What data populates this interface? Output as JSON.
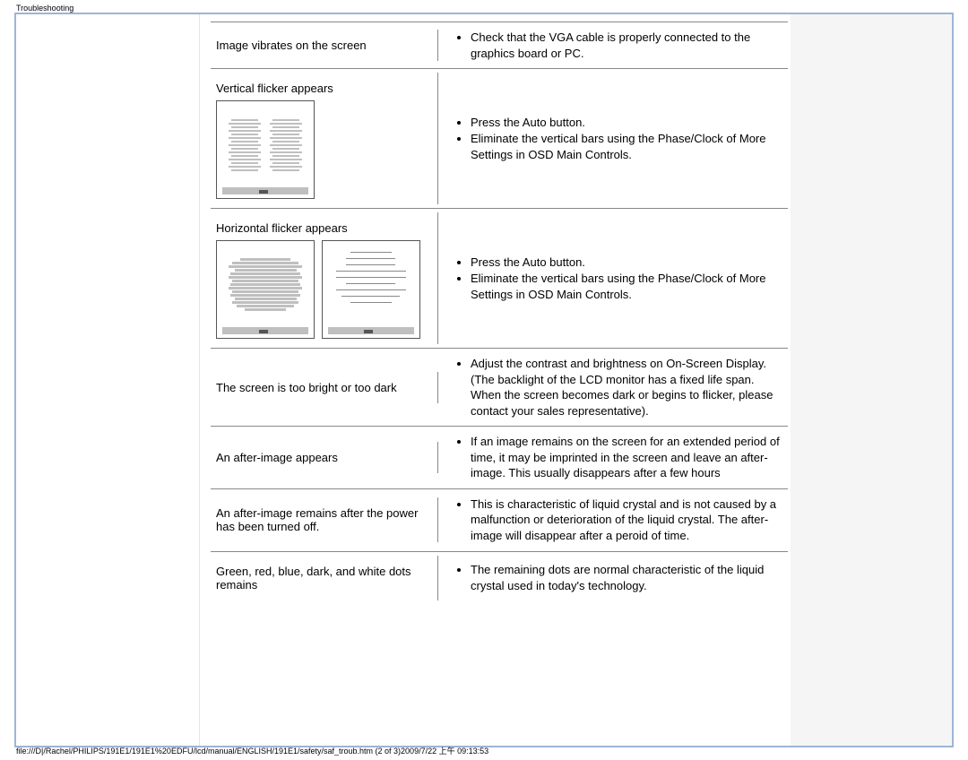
{
  "header": {
    "title": "Troubleshooting"
  },
  "rows": [
    {
      "problem": "Image vibrates on the screen",
      "solutions": [
        "Check that the VGA cable is properly connected to the graphics board or PC."
      ]
    },
    {
      "problem": "Vertical flicker appears",
      "solutions": [
        "Press the Auto button.",
        "Eliminate the vertical bars using the Phase/Clock of More Settings in OSD Main Controls."
      ]
    },
    {
      "problem": "Horizontal flicker appears",
      "solutions": [
        "Press the Auto button.",
        "Eliminate the vertical bars using the Phase/Clock of More Settings in OSD Main Controls."
      ]
    },
    {
      "problem": "The screen is too bright or too dark",
      "solutions": [
        "Adjust the contrast and brightness on On-Screen Display. (The backlight of the LCD monitor has a fixed life span. When the screen becomes dark or begins to flicker, please contact your sales representative)."
      ]
    },
    {
      "problem": "An after-image appears",
      "solutions": [
        "If an image remains on the screen for an extended period of time, it may be imprinted in the screen and leave an after-image. This usually disappears after a few hours"
      ]
    },
    {
      "problem": "An after-image remains after the power has been turned off.",
      "solutions": [
        "This is characteristic of liquid crystal and is not caused by a malfunction or deterioration of the liquid crystal. The after-image will disappear after a peroid of time."
      ]
    },
    {
      "problem": "Green, red, blue, dark, and white dots remains",
      "solutions": [
        "The remaining dots are normal characteristic of the liquid crystal used in today's technology."
      ]
    }
  ],
  "footer": {
    "path": "file:///D|/Rachel/PHILIPS/191E1/191E1%20EDFU/lcd/manual/ENGLISH/191E1/safety/saf_troub.htm (2 of 3)2009/7/22 上午 09:13:53"
  }
}
